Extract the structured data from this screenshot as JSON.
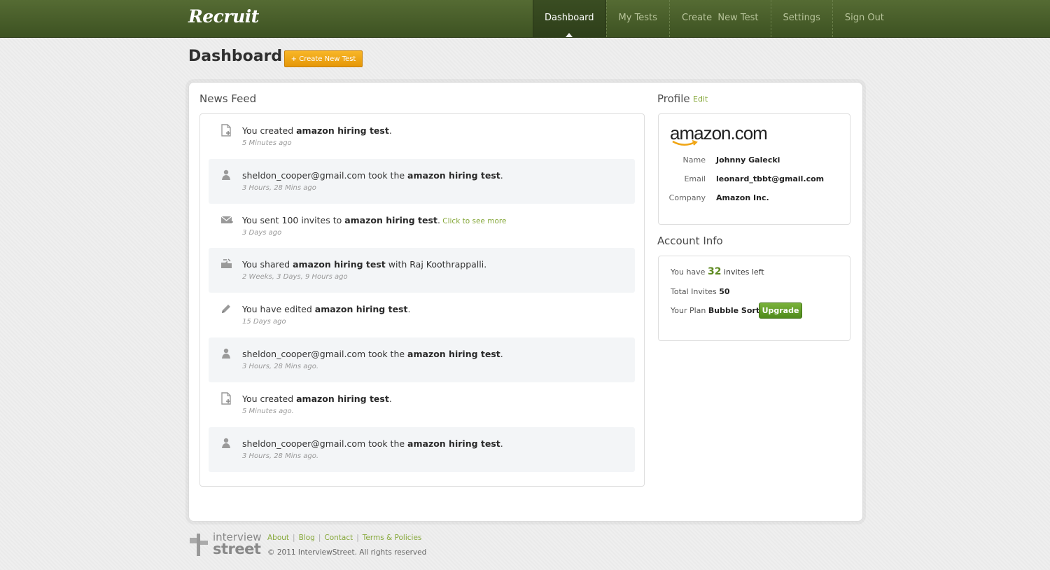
{
  "app": {
    "logo": "Recruit"
  },
  "nav": {
    "items": [
      {
        "label": "Dashboard",
        "active": true
      },
      {
        "label": "My Tests"
      },
      {
        "label": "Create  New Test"
      },
      {
        "label": "Settings"
      },
      {
        "label": "Sign Out"
      }
    ]
  },
  "header": {
    "title": "Dashboard",
    "create_button": "+ Create New Test"
  },
  "news_feed": {
    "title": "News Feed",
    "items": [
      {
        "icon": "document-add-icon",
        "pre": "You created ",
        "bold": "amazon hiring test",
        "post": ".",
        "link": "",
        "time": "5 Minutes ago"
      },
      {
        "icon": "user-icon",
        "pre": "sheldon_cooper@gmail.com took the ",
        "bold": "amazon hiring test",
        "post": ".",
        "link": "",
        "time": "3 Hours, 28 Mins ago"
      },
      {
        "icon": "envelope-icon",
        "pre": "You sent 100 invites to ",
        "bold": "amazon hiring test",
        "post": ".",
        "link": "Click to see more",
        "time": "3 Days ago"
      },
      {
        "icon": "share-icon",
        "pre": "You shared ",
        "bold": "amazon hiring test",
        "post": " with Raj Koothrappalli.",
        "link": "",
        "time": "2 Weeks, 3 Days, 9 Hours ago"
      },
      {
        "icon": "pencil-icon",
        "pre": "You have edited ",
        "bold": "amazon hiring test",
        "post": ".",
        "link": "",
        "time": "15 Days ago"
      },
      {
        "icon": "user-icon",
        "pre": "sheldon_cooper@gmail.com took the ",
        "bold": "amazon hiring test",
        "post": ".",
        "link": "",
        "time": "3 Hours, 28 Mins ago."
      },
      {
        "icon": "document-add-icon",
        "pre": "You created ",
        "bold": "amazon hiring test",
        "post": ".",
        "link": "",
        "time": "5 Minutes ago."
      },
      {
        "icon": "user-icon",
        "pre": "sheldon_cooper@gmail.com took the ",
        "bold": "amazon hiring test",
        "post": ".",
        "link": "",
        "time": "3 Hours, 28 Mins ago."
      }
    ]
  },
  "profile": {
    "title": "Profile",
    "edit_label": "Edit",
    "company_logo_text": "amazon.com",
    "fields": [
      {
        "label": "Name",
        "value": "Johnny Galecki"
      },
      {
        "label": "Email",
        "value": "leonard_tbbt@gmail.com"
      },
      {
        "label": "Company",
        "value": "Amazon Inc."
      }
    ]
  },
  "account": {
    "title": "Account Info",
    "invites_prefix": "You have ",
    "invites_left": "32",
    "invites_suffix": " invites left",
    "total_label": "Total Invites ",
    "total_value": "50",
    "plan_label": "Your Plan ",
    "plan_value": "Bubble Sort",
    "upgrade_label": "Upgrade"
  },
  "footer": {
    "brand_line1": "interview",
    "brand_line2": "street",
    "links": [
      "About",
      "Blog",
      "Contact",
      "Terms & Policies"
    ],
    "copyright": "© 2011 InterviewStreet. All rights reserved"
  },
  "colors": {
    "topbar": "#4a5f2b",
    "accent_green": "#86a83a",
    "orange_button": "#f0a514",
    "upgrade_green": "#5e9a26"
  }
}
